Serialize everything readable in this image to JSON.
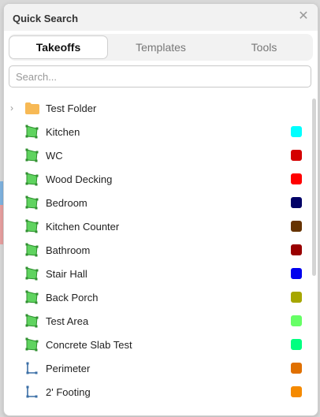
{
  "panel": {
    "title": "Quick Search"
  },
  "tabs": [
    {
      "label": "Takeoffs",
      "active": true
    },
    {
      "label": "Templates",
      "active": false
    },
    {
      "label": "Tools",
      "active": false
    }
  ],
  "search": {
    "placeholder": "Search..."
  },
  "folder": {
    "label": "Test Folder",
    "icon": "folder-icon"
  },
  "items": [
    {
      "label": "Kitchen",
      "icon": "area-icon",
      "color": "#00ffff"
    },
    {
      "label": "WC",
      "icon": "area-icon",
      "color": "#d40000"
    },
    {
      "label": "Wood Decking",
      "icon": "area-icon",
      "color": "#ff0000"
    },
    {
      "label": "Bedroom",
      "icon": "area-icon",
      "color": "#000066"
    },
    {
      "label": "Kitchen Counter",
      "icon": "area-icon",
      "color": "#663300"
    },
    {
      "label": "Bathroom",
      "icon": "area-icon",
      "color": "#990000"
    },
    {
      "label": "Stair Hall",
      "icon": "area-icon",
      "color": "#0000ee"
    },
    {
      "label": "Back Porch",
      "icon": "area-icon",
      "color": "#a6a600"
    },
    {
      "label": "Test Area",
      "icon": "area-icon",
      "color": "#66ff66"
    },
    {
      "label": "Concrete Slab Test",
      "icon": "area-icon",
      "color": "#00ff80"
    },
    {
      "label": "Perimeter",
      "icon": "linear-icon",
      "color": "#e07000"
    },
    {
      "label": "2' Footing",
      "icon": "linear-icon",
      "color": "#f58a00"
    }
  ]
}
